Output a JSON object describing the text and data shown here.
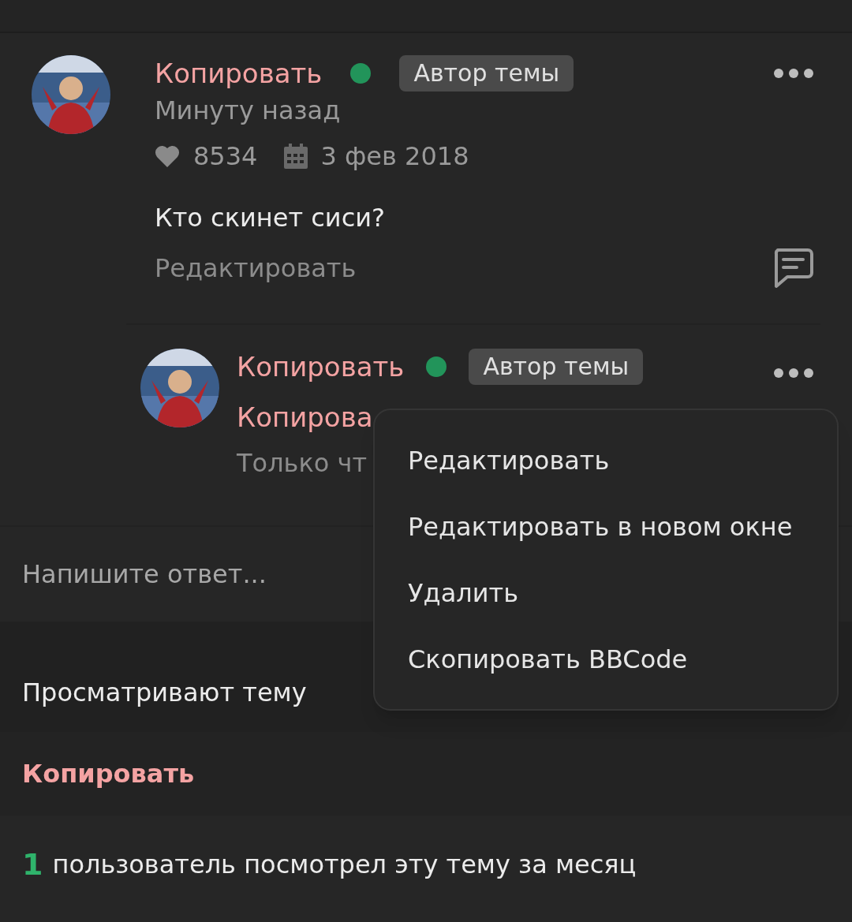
{
  "post": {
    "author": "Копировать",
    "online": true,
    "badge": "Автор темы",
    "time": "Минуту назад",
    "likes": "8534",
    "registered": "3 фев 2018",
    "text": "Кто скинет сиси?",
    "edit_link": "Редактировать"
  },
  "reply": {
    "author": "Копировать",
    "online": true,
    "badge": "Автор темы",
    "line_2": "Копирова",
    "time": "Только чт"
  },
  "menu": [
    "Редактировать",
    "Редактировать в новом окне",
    "Удалить",
    "Скопировать BBCode"
  ],
  "reply_field": {
    "placeholder": "Напишите ответ..."
  },
  "viewers": {
    "title": "Просматривают тему",
    "users": [
      "Копировать"
    ]
  },
  "monthly": {
    "count": "1",
    "text": "пользователь посмотрел эту тему за месяц"
  }
}
